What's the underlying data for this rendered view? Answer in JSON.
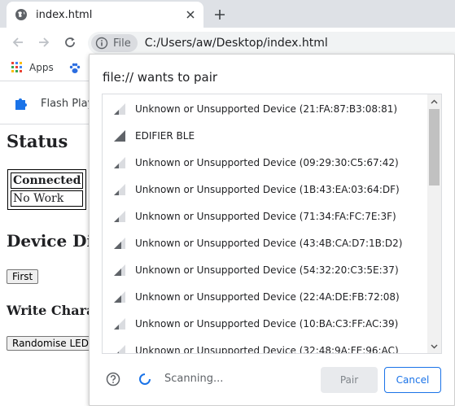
{
  "browser": {
    "tab_title": "index.html",
    "chip_label": "File",
    "url": "C:/Users/aw/Desktop/index.html",
    "bookmarks": [
      {
        "label": "Apps",
        "icon": "apps-grid-icon"
      },
      {
        "label": "",
        "icon": "paw-icon"
      }
    ],
    "extension_label": "Flash Play"
  },
  "page": {
    "status_heading": "Status",
    "status_table": [
      "Connected",
      "No Work"
    ],
    "device_heading": "Device Dis",
    "first_button": "First",
    "write_heading": "Write Chara",
    "randomise_button": "Randomise LED"
  },
  "dialog": {
    "title": "file:// wants to pair",
    "devices": [
      {
        "name": "Unknown or Unsupported Device (21:FA:87:B3:08:81)",
        "signal": "low"
      },
      {
        "name": "EDIFIER BLE",
        "signal": "high"
      },
      {
        "name": "Unknown or Unsupported Device (09:29:30:C5:67:42)",
        "signal": "low"
      },
      {
        "name": "Unknown or Unsupported Device (1B:43:EA:03:64:DF)",
        "signal": "low"
      },
      {
        "name": "Unknown or Unsupported Device (71:34:FA:FC:7E:3F)",
        "signal": "low"
      },
      {
        "name": "Unknown or Unsupported Device (43:4B:CA:D7:1B:D2)",
        "signal": "medium"
      },
      {
        "name": "Unknown or Unsupported Device (54:32:20:C3:5E:37)",
        "signal": "medium"
      },
      {
        "name": "Unknown or Unsupported Device (22:4A:DE:FB:72:08)",
        "signal": "medium"
      },
      {
        "name": "Unknown or Unsupported Device (10:BA:C3:FF:AC:39)",
        "signal": "low"
      },
      {
        "name": "Unknown or Unsupported Device (32:48:9A:FE:96:AC)",
        "signal": "low"
      }
    ],
    "scanning_text": "Scanning...",
    "pair_button": "Pair",
    "cancel_button": "Cancel"
  },
  "colors": {
    "accent": "#1a73e8",
    "tabstrip": "#dee1e6",
    "signal_dark": "#5f6368",
    "signal_light": "#dadce0"
  }
}
